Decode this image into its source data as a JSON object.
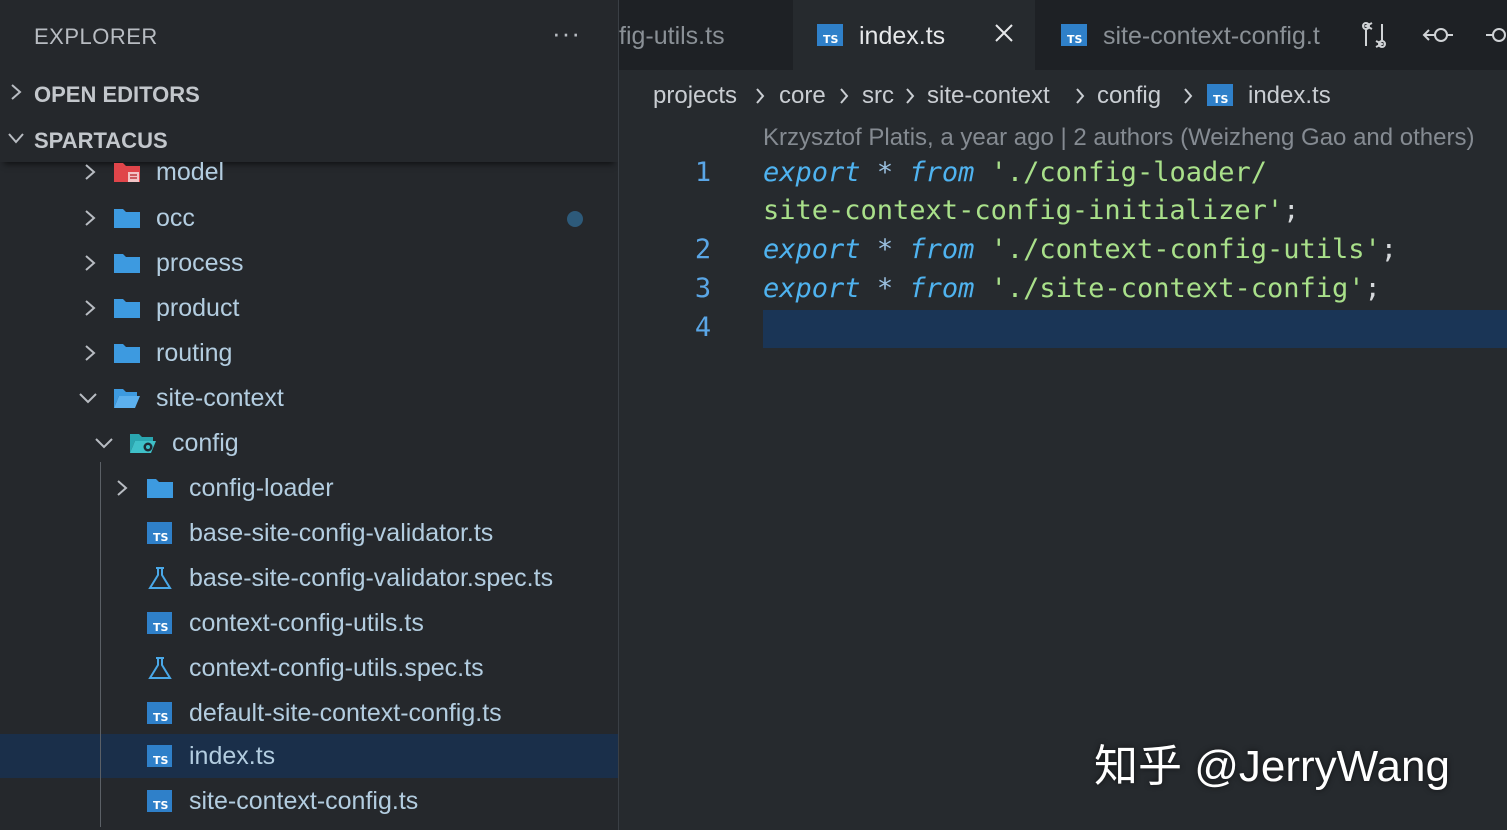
{
  "sidebar": {
    "title": "EXPLORER",
    "more": "···",
    "sections": {
      "open_editors": "OPEN EDITORS",
      "project": "SPARTACUS"
    },
    "tree": [
      {
        "label": "model",
        "kind": "folder-special"
      },
      {
        "label": "occ",
        "kind": "folder",
        "modified": true
      },
      {
        "label": "process",
        "kind": "folder"
      },
      {
        "label": "product",
        "kind": "folder"
      },
      {
        "label": "routing",
        "kind": "folder"
      },
      {
        "label": "site-context",
        "kind": "folder-open"
      },
      {
        "label": "config",
        "kind": "folder-config-open"
      },
      {
        "label": "config-loader",
        "kind": "folder"
      },
      {
        "label": "base-site-config-validator.ts",
        "kind": "ts"
      },
      {
        "label": "base-site-config-validator.spec.ts",
        "kind": "spec"
      },
      {
        "label": "context-config-utils.ts",
        "kind": "ts"
      },
      {
        "label": "context-config-utils.spec.ts",
        "kind": "spec"
      },
      {
        "label": "default-site-context-config.ts",
        "kind": "ts"
      },
      {
        "label": "index.ts",
        "kind": "ts",
        "selected": true
      },
      {
        "label": "site-context-config.ts",
        "kind": "ts"
      }
    ]
  },
  "tabs": [
    {
      "label": "fig-utils.ts",
      "active": false
    },
    {
      "label": "index.ts",
      "active": true
    },
    {
      "label": "site-context-config.t",
      "active": false
    }
  ],
  "breadcrumb": [
    "projects",
    "core",
    "src",
    "site-context",
    "config",
    "index.ts"
  ],
  "blame": "Krzysztof Platis, a year ago | 2 authors (Weizheng Gao and others)",
  "code": {
    "line_numbers": [
      "1",
      "2",
      "3",
      "4"
    ],
    "lines": [
      {
        "kw": "export",
        "op": "*",
        "kw2": "from",
        "str": "'./config-loader/"
      },
      {
        "str": "site-context-config-initializer'",
        "punc": ";"
      },
      {
        "kw": "export",
        "op": "*",
        "kw2": "from",
        "str": "'./context-config-utils'",
        "punc": ";"
      },
      {
        "kw": "export",
        "op": "*",
        "kw2": "from",
        "str": "'./site-context-config'",
        "punc": ";"
      }
    ]
  },
  "watermark": "知乎 @JerryWang",
  "colors": {
    "accent": "#4fb3f0",
    "string": "#a9e08a",
    "selection": "#1a2f4a",
    "folder": "#3d9ae0"
  }
}
